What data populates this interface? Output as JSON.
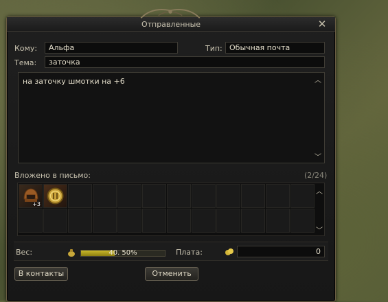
{
  "window": {
    "title": "Отправленные"
  },
  "form": {
    "to_label": "Кому:",
    "to_value": "Альфа",
    "type_label": "Тип:",
    "type_value": "Обычная почта",
    "subject_label": "Тема:",
    "subject_value": "заточка",
    "body_text": "на заточку шмотки на +6"
  },
  "attachments": {
    "label": "Вложено в письмо:",
    "count": "(2/24)",
    "items": [
      {
        "icon": "helmet-item-icon",
        "qty": "+3"
      },
      {
        "icon": "coin-item-icon",
        "qty": ""
      }
    ]
  },
  "footer": {
    "weight_label": "Вес:",
    "weight_text": "40. 50%",
    "weight_fraction": 0.405,
    "fee_label": "Плата:",
    "fee_value": "0"
  },
  "buttons": {
    "contacts": "В контакты",
    "cancel": "Отменить"
  },
  "colors": {
    "panel": "#1b1b1b",
    "border_gold": "#6a5d43",
    "weight_fill": "#c9b82b"
  }
}
